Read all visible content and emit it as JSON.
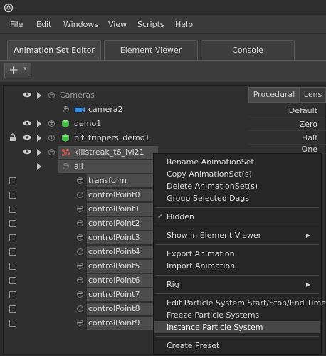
{
  "menubar": {
    "items": [
      "File",
      "Edit",
      "Windows",
      "View",
      "Scripts",
      "Help"
    ]
  },
  "tabs": [
    "Animation Set Editor",
    "Element Viewer",
    "Console"
  ],
  "toolbar": {
    "add_label": "+"
  },
  "tree": {
    "rows": [
      {
        "label": "Cameras"
      },
      {
        "label": "camera2"
      },
      {
        "label": "demo1"
      },
      {
        "label": "bit_trippers_demo1"
      },
      {
        "label": "killstreak_t6_lvl21"
      },
      {
        "label": "all"
      },
      {
        "label": "transform"
      },
      {
        "label": "controlPoint0"
      },
      {
        "label": "controlPoint1"
      },
      {
        "label": "controlPoint2"
      },
      {
        "label": "controlPoint3"
      },
      {
        "label": "controlPoint4"
      },
      {
        "label": "controlPoint5"
      },
      {
        "label": "controlPoint6"
      },
      {
        "label": "controlPoint7"
      },
      {
        "label": "controlPoint8"
      },
      {
        "label": "controlPoint9"
      }
    ]
  },
  "right_panel": {
    "tabs": [
      "Procedural",
      "Lens"
    ],
    "rows": [
      "Default",
      "Zero",
      "Half",
      "One"
    ]
  },
  "context_menu": {
    "items": [
      "Rename AnimationSet",
      "Copy AnimationSet(s)",
      "Delete AnimationSet(s)",
      "Group Selected Dags",
      "Hidden",
      "Show in Element Viewer",
      "Export Animation",
      "Import Animation",
      "Rig",
      "Edit Particle System Start/Stop/End Times",
      "Freeze Particle Systems",
      "Instance Particle System",
      "Create Preset"
    ]
  },
  "icons": {
    "app": "app-logo-icon",
    "visibility": "eye-icon",
    "lock": "lock-icon",
    "camera": "camera-icon",
    "model": "green-cube-icon",
    "particle": "particle-system-icon",
    "expand": "plus-circle-icon",
    "collapse": "minus-circle-icon",
    "submenu": "chevron-right-icon",
    "check": "checkmark-icon"
  }
}
